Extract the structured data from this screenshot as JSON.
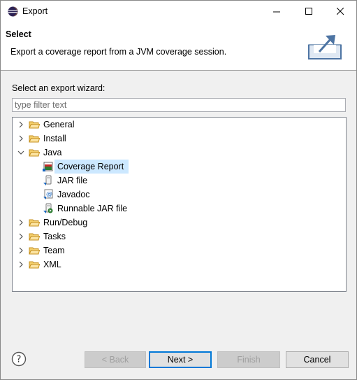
{
  "window": {
    "title": "Export",
    "icon": "eclipse-icon",
    "controls": [
      "minimize",
      "maximize",
      "close"
    ]
  },
  "header": {
    "title": "Select",
    "description": "Export a coverage report from a JVM coverage session.",
    "image": "export-wizard-banner-icon"
  },
  "wizard": {
    "label": "Select an export wizard:",
    "filter": {
      "placeholder": "type filter text",
      "value": ""
    }
  },
  "tree": {
    "items": [
      {
        "label": "General",
        "icon": "folder-icon",
        "expanded": false
      },
      {
        "label": "Install",
        "icon": "folder-icon",
        "expanded": false
      },
      {
        "label": "Java",
        "icon": "folder-icon",
        "expanded": true,
        "children": [
          {
            "label": "Coverage Report",
            "icon": "coverage-report-icon",
            "selected": true
          },
          {
            "label": "JAR file",
            "icon": "jar-file-icon"
          },
          {
            "label": "Javadoc",
            "icon": "javadoc-icon"
          },
          {
            "label": "Runnable JAR file",
            "icon": "runnable-jar-icon"
          }
        ]
      },
      {
        "label": "Run/Debug",
        "icon": "folder-icon",
        "expanded": false
      },
      {
        "label": "Tasks",
        "icon": "folder-icon",
        "expanded": false
      },
      {
        "label": "Team",
        "icon": "folder-icon",
        "expanded": false
      },
      {
        "label": "XML",
        "icon": "folder-icon",
        "expanded": false
      }
    ]
  },
  "footer": {
    "help_icon": "help-icon",
    "back": "< Back",
    "next": "Next >",
    "finish": "Finish",
    "cancel": "Cancel"
  },
  "colors": {
    "selection": "#cce8ff",
    "folder": "#e8b54a",
    "accent": "#0078d7"
  }
}
